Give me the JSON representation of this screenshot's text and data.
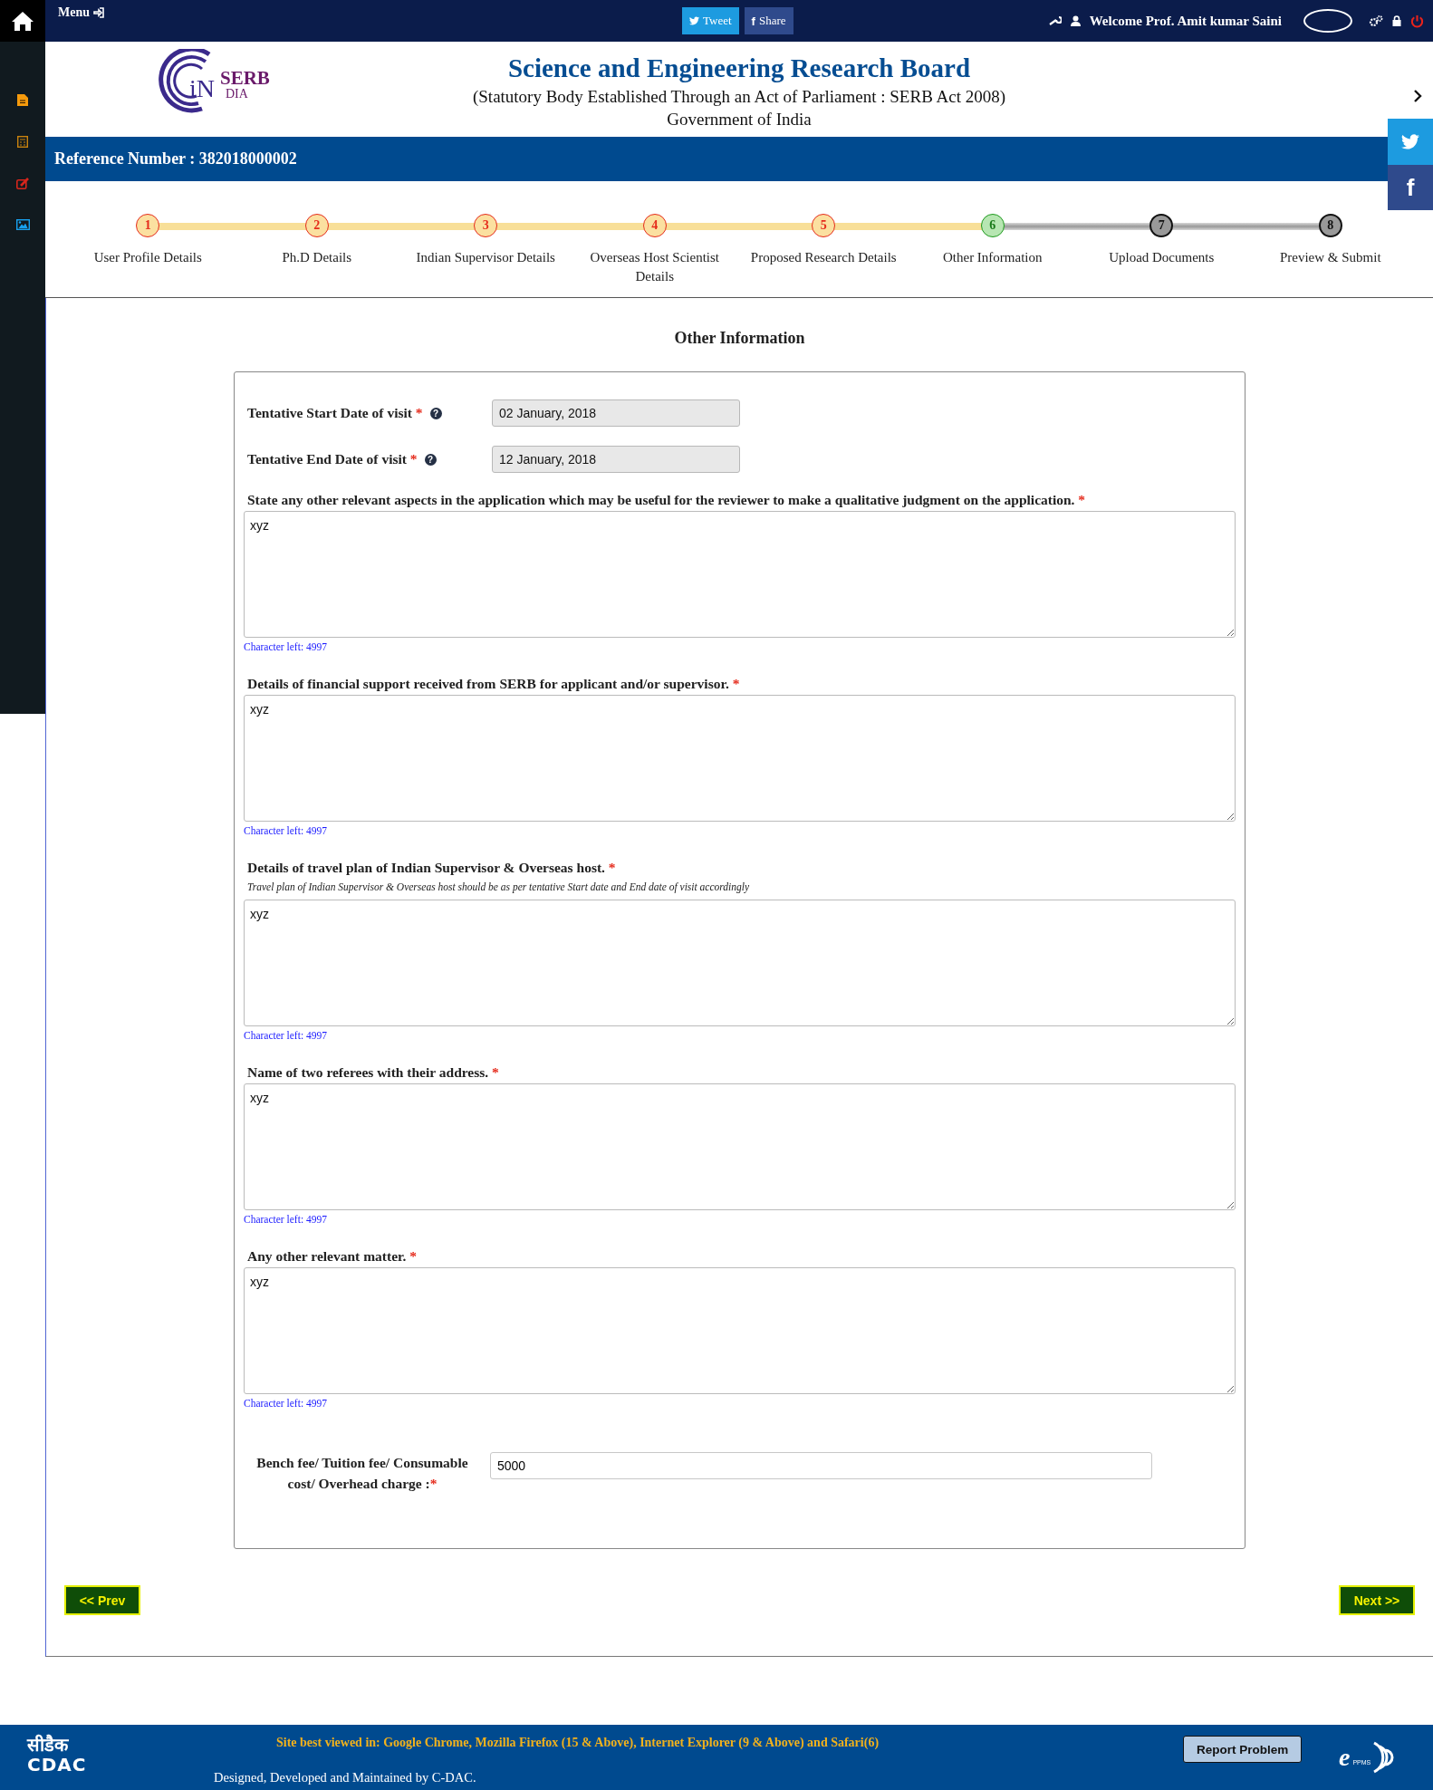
{
  "top_bar": {
    "menu": "Menu",
    "tweet": "Tweet",
    "share_glyph": "f",
    "share": "Share",
    "welcome": "Welcome Prof. Amit kumar Saini"
  },
  "header": {
    "logo": {
      "letters": "iN",
      "name": "SERB",
      "sub": "DIA"
    },
    "title": "Science and Engineering Research Board",
    "subtitle": "(Statutory Body Established Through an Act of Parliament : SERB Act 2008)",
    "country": "Government of India"
  },
  "side_social": {
    "facebook": "f"
  },
  "reference": "Reference Number : 382018000002",
  "steps": [
    {
      "number": "1",
      "label": "User Profile Details",
      "completed": true,
      "selected": false
    },
    {
      "number": "2",
      "label": "Ph.D Details",
      "completed": true,
      "selected": false
    },
    {
      "number": "3",
      "label": "Indian Supervisor Details",
      "completed": true,
      "selected": false
    },
    {
      "number": "4",
      "label": "Overseas Host Scientist Details",
      "completed": true,
      "selected": false
    },
    {
      "number": "5",
      "label": "Proposed Research Details",
      "completed": true,
      "selected": false
    },
    {
      "number": "6",
      "label": "Other Information",
      "completed": false,
      "selected": true
    },
    {
      "number": "7",
      "label": "Upload Documents",
      "completed": false,
      "selected": false
    },
    {
      "number": "8",
      "label": "Preview & Submit",
      "completed": false,
      "selected": false
    }
  ],
  "section_title": "Other Information",
  "date_fields": [
    {
      "label": "Tentative Start Date of visit",
      "mark": "*",
      "help": "?",
      "value": "02 January, 2018"
    },
    {
      "label": "Tentative End Date of visit",
      "mark": "*",
      "help": "?",
      "value": "12 January, 2018"
    }
  ],
  "text_areas": [
    {
      "label": "State any other relevant aspects in the application which may be useful for the reviewer to make a qualitative judgment on the application.",
      "mark": "*",
      "value": "xyz",
      "counter": "Character left: 4997"
    },
    {
      "label": "Details of financial support received from SERB for applicant and/or supervisor.",
      "mark": "*",
      "value": "xyz",
      "counter": "Character left: 4997"
    },
    {
      "label": "Details of travel plan of Indian Supervisor & Overseas host.",
      "mark": "*",
      "note": "Travel plan of Indian Supervisor & Overseas host should be as per tentative Start date and End date of visit accordingly",
      "value": "xyz",
      "counter": "Character left: 4997"
    },
    {
      "label": "Name of two referees with their address.",
      "mark": "*",
      "value": "xyz",
      "counter": "Character left: 4997"
    },
    {
      "label": "Any other relevant matter.",
      "mark": "*",
      "value": "xyz",
      "counter": "Character left: 4997"
    }
  ],
  "fee_field": {
    "label": "Bench fee/ Tuition fee/ Consumable cost/ Overhead charge :",
    "mark": "*",
    "value": "5000"
  },
  "buttons": {
    "prev": "<< Prev",
    "next": "Next >>"
  },
  "footer": {
    "cdac_hindi": "सीडैक",
    "cdac": "CDAC",
    "browsers": "Site best viewed in: Google Chrome, Mozilla Firefox (15 & Above), Internet Explorer (9 & Above) and Safari(6)",
    "credit": "Designed, Developed and Maintained by C-DAC.",
    "report": "Report Problem",
    "eppms_letter": "e",
    "eppms": "PPMS"
  }
}
